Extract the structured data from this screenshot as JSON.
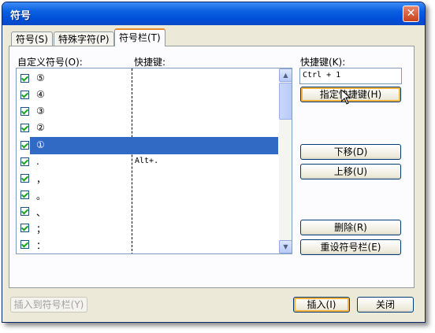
{
  "window": {
    "title": "符号",
    "close_glyph": "✕"
  },
  "tabs": [
    {
      "label": "符号(S)"
    },
    {
      "label": "特殊字符(P)"
    },
    {
      "label": "符号栏(T)"
    }
  ],
  "list": {
    "header_symbol": "自定义符号(O):",
    "header_shortcut": "快捷键:",
    "items": [
      {
        "symbol": "⑤",
        "shortcut": "",
        "checked": true
      },
      {
        "symbol": "④",
        "shortcut": "",
        "checked": true
      },
      {
        "symbol": "③",
        "shortcut": "",
        "checked": true
      },
      {
        "symbol": "②",
        "shortcut": "",
        "checked": true
      },
      {
        "symbol": "①",
        "shortcut": "",
        "checked": true,
        "selected": true
      },
      {
        "symbol": ".",
        "shortcut": "Alt+.",
        "checked": true
      },
      {
        "symbol": "，",
        "shortcut": "",
        "checked": true
      },
      {
        "symbol": "。",
        "shortcut": "",
        "checked": true
      },
      {
        "symbol": "、",
        "shortcut": "",
        "checked": true
      },
      {
        "symbol": "；",
        "shortcut": "",
        "checked": true
      },
      {
        "symbol": "：",
        "shortcut": "",
        "checked": true
      }
    ]
  },
  "shortcut": {
    "label": "快捷键(K):",
    "value": "Ctrl + 1"
  },
  "buttons": {
    "assign": "指定快捷键(H)",
    "move_down": "下移(D)",
    "move_up": "上移(U)",
    "delete": "删除(R)",
    "reset": "重设符号栏(E)",
    "insert_to_bar": "插入到符号栏(Y)",
    "insert": "插入(I)",
    "close": "关闭"
  },
  "icons": {
    "scroll_up": "▲",
    "scroll_down": "▼"
  }
}
